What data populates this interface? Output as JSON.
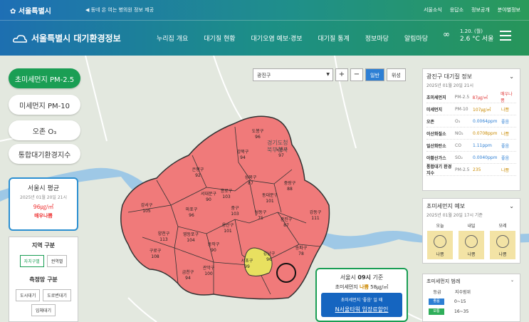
{
  "topbar": {
    "logo": "서울특별시",
    "notice": "◀ 동네 온 여는 병의원 정보 제공",
    "links": [
      "서울소식",
      "응답소",
      "정보공개",
      "분야별정보"
    ]
  },
  "header": {
    "site_title": "서울특별시 대기환경정보",
    "nav": [
      "누리집 개요",
      "대기질 현황",
      "대기오염 예보·경보",
      "대기질 통계",
      "정보마당",
      "알림마당"
    ],
    "weather_date": "1.20. (월)",
    "weather_temp": "2.6 °C 서울"
  },
  "pollutants": [
    "초미세먼지 PM-2.5",
    "미세먼지 PM-10",
    "오존 O₃",
    "통합대기환경지수"
  ],
  "seoul_avg": {
    "title": "서울시 평균",
    "datetime": "2025년 01월 20일 21시",
    "value": "96㎍/㎥",
    "grade": "매우나쁨"
  },
  "region": {
    "title": "지역 구분",
    "buttons": [
      "자치구별",
      "권역별"
    ]
  },
  "network": {
    "title": "측정망 구분",
    "buttons": [
      "도시대기",
      "도로변대기",
      "입체대기"
    ]
  },
  "map_controls": {
    "district": "광진구",
    "zoom_in": "+",
    "zoom_out": "−",
    "type_general": "일반",
    "type_satellite": "위성"
  },
  "districts": [
    {
      "name": "도봉구",
      "value": "96"
    },
    {
      "name": "노원구",
      "value": "97"
    },
    {
      "name": "강북구",
      "value": "94"
    },
    {
      "name": "은평구",
      "value": "92"
    },
    {
      "name": "성북구",
      "value": "87"
    },
    {
      "name": "종로구",
      "value": "103"
    },
    {
      "name": "중랑구",
      "value": "88"
    },
    {
      "name": "서대문구",
      "value": "90"
    },
    {
      "name": "동대문구",
      "value": "101"
    },
    {
      "name": "마포구",
      "value": "96"
    },
    {
      "name": "중구",
      "value": "103"
    },
    {
      "name": "강서구",
      "value": "105"
    },
    {
      "name": "용산구",
      "value": "101"
    },
    {
      "name": "성동구",
      "value": "75"
    },
    {
      "name": "광진구",
      "value": "87"
    },
    {
      "name": "강동구",
      "value": "111"
    },
    {
      "name": "양천구",
      "value": "113"
    },
    {
      "name": "영등포구",
      "value": "104"
    },
    {
      "name": "동작구",
      "value": "90"
    },
    {
      "name": "구로구",
      "value": "108"
    },
    {
      "name": "송파구",
      "value": "78"
    },
    {
      "name": "강남구",
      "value": "96"
    },
    {
      "name": "서초구",
      "value": "99"
    },
    {
      "name": "관악구",
      "value": "100"
    },
    {
      "name": "금천구",
      "value": "94"
    }
  ],
  "map_labels": [
    "경기도청",
    "북부청사"
  ],
  "info": {
    "title": "광진구 대기질 정보",
    "datetime": "2025년 01월 20일 21시",
    "rows": [
      {
        "name": "초미세먼지",
        "sym": "PM-2.5",
        "val": "87㎍/㎥",
        "grade": "매우나쁨",
        "color": "#e03a3a"
      },
      {
        "name": "미세먼지",
        "sym": "PM-10",
        "val": "107㎍/㎥",
        "grade": "나쁨",
        "color": "#c98a00"
      },
      {
        "name": "오존",
        "sym": "O₃",
        "val": "0.0064ppm",
        "grade": "좋음",
        "color": "#2d7fd4"
      },
      {
        "name": "이산화질소",
        "sym": "NO₂",
        "val": "0.0708ppm",
        "grade": "나쁨",
        "color": "#c98a00"
      },
      {
        "name": "일산화탄소",
        "sym": "CO",
        "val": "1.11ppm",
        "grade": "좋음",
        "color": "#2d7fd4"
      },
      {
        "name": "아황산가스",
        "sym": "SO₂",
        "val": "0.0040ppm",
        "grade": "좋음",
        "color": "#2d7fd4"
      },
      {
        "name": "통합대기 환경지수",
        "sym": "PM-2.5",
        "val": "235",
        "grade": "나쁨",
        "color": "#c98a00"
      }
    ]
  },
  "forecast": {
    "title": "초미세먼지 예보",
    "datetime": "2025년 01월 20일 17시 기준",
    "days": [
      {
        "label": "오늘",
        "grade": "나쁨"
      },
      {
        "label": "내일",
        "grade": "나쁨"
      },
      {
        "label": "모레",
        "grade": "나쁨"
      }
    ]
  },
  "legend": {
    "title": "초미세먼지 범례",
    "col1": "등급",
    "col2": "지수범위",
    "rows": [
      {
        "grade": "좋음",
        "range": "0~15",
        "color": "#2d7fd4"
      },
      {
        "grade": "보통",
        "range": "16~35",
        "color": "#2fae5a"
      }
    ]
  },
  "promo": {
    "title_pre": "서울시 ",
    "title_bold": "09시",
    "title_post": " 기준",
    "status_pre": "초미세먼지 ",
    "status_grade": "나쁨",
    "status_val": " 58㎍/㎥",
    "btn_small": "초미세먼지 '좋음' 일 때",
    "btn_big": "N서울타워 입장료할인"
  },
  "colors": {
    "bad": "#f07a7a",
    "moderate": "#e8e060",
    "accent": "#1a9e54"
  }
}
